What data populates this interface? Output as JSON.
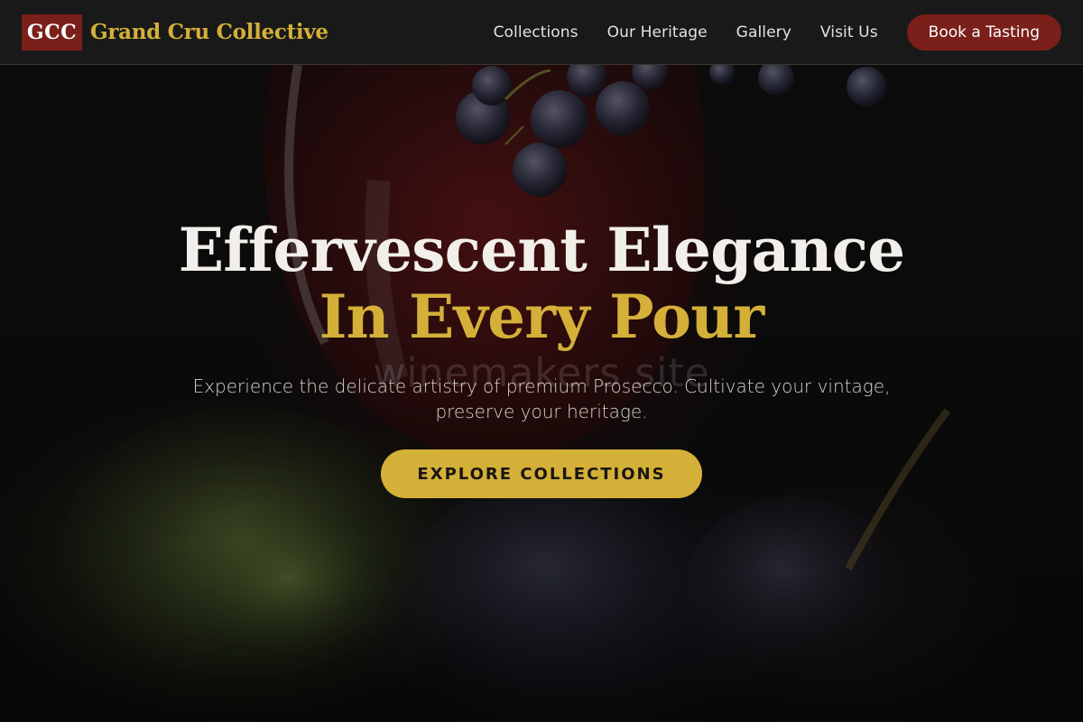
{
  "brand": {
    "badge": "GCC",
    "name": "Grand Cru Collective"
  },
  "nav": {
    "links": [
      "Collections",
      "Our Heritage",
      "Gallery",
      "Visit Us"
    ],
    "cta": "Book a Tasting"
  },
  "hero": {
    "title_line1": "Effervescent Elegance",
    "title_line2": "In Every Pour",
    "watermark": "winemakers site",
    "subtitle": "Experience the delicate artistry of premium Prosecco. Cultivate your vintage, preserve your heritage.",
    "button": "EXPLORE COLLECTIONS",
    "background_image": "wine-glass-and-grapes-photo"
  },
  "colors": {
    "accent_gold": "#d4b038",
    "wine_red": "#7a1f1a",
    "header_bg": "#1a1a1a"
  }
}
